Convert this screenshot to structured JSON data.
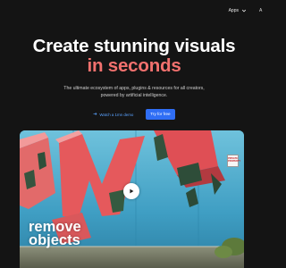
{
  "nav": {
    "apps_label": "Apps",
    "extra_label": "A"
  },
  "hero": {
    "headline_line1": "Create stunning visuals",
    "headline_line2": "in seconds",
    "subtitle_line1": "The ultimate ecosystem of apps, plugins & resources for all creators,",
    "subtitle_line2": "powered by artificial intelligence.",
    "watch_demo_label": "Watch a 1mn demo",
    "try_free_label": "Try for free"
  },
  "video": {
    "caption_line1": "remove",
    "caption_line2": "objects",
    "graffiti_text": "EW",
    "sign_line1": "PRIVATE",
    "sign_line2": "PROPERTY"
  },
  "colors": {
    "background": "#141414",
    "accent_headline": "#f2716e",
    "primary_button": "#2f6ef5",
    "link": "#5aa2ff"
  },
  "icons": {
    "apps_dropdown": "chevron-down-icon",
    "watch_demo": "arrow-right-icon",
    "video": "play-icon"
  }
}
